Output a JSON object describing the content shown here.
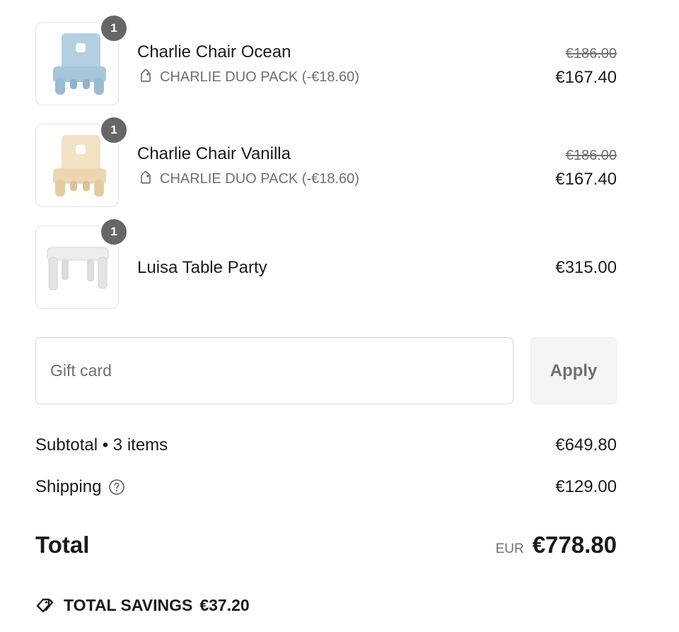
{
  "cart": {
    "items": [
      {
        "name": "Charlie Chair Ocean",
        "quantity": "1",
        "discount": "CHARLIE DUO PACK (-€18.60)",
        "original_price": "€186.00",
        "price": "€167.40",
        "image": "chair-ocean-thumbnail",
        "color": "#a9c8dc"
      },
      {
        "name": "Charlie Chair Vanilla",
        "quantity": "1",
        "discount": "CHARLIE DUO PACK (-€18.60)",
        "original_price": "€186.00",
        "price": "€167.40",
        "image": "chair-vanilla-thumbnail",
        "color": "#efdcba"
      },
      {
        "name": "Luisa Table Party",
        "quantity": "1",
        "price": "€315.00",
        "image": "table-party-thumbnail",
        "color": "#ececec"
      }
    ]
  },
  "gift_card": {
    "placeholder": "Gift card",
    "apply_label": "Apply"
  },
  "summary": {
    "subtotal_label": "Subtotal • 3 items",
    "subtotal_value": "€649.80",
    "shipping_label": "Shipping",
    "shipping_value": "€129.00",
    "total_label": "Total",
    "currency": "EUR",
    "total_value": "€778.80",
    "savings_label": "TOTAL SAVINGS",
    "savings_value": "€37.20"
  },
  "icons": {
    "discount_tag": "tag-icon",
    "shipping_help": "question-circle-icon",
    "savings_tag": "tags-icon"
  },
  "colors": {
    "badge": "#666666",
    "muted_text": "#707070",
    "text": "#1a1a1a",
    "border": "#e1e1e1"
  }
}
